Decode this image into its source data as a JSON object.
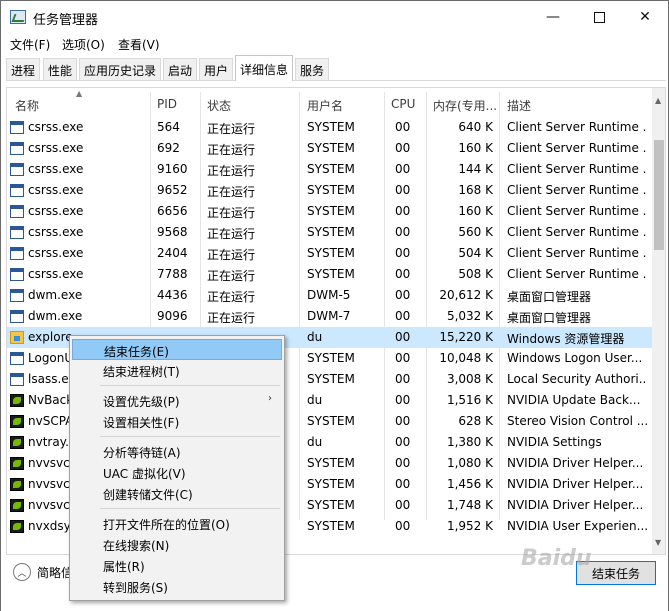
{
  "window": {
    "title": "任务管理器"
  },
  "menubar": [
    "文件(F)",
    "选项(O)",
    "查看(V)"
  ],
  "tabs": [
    {
      "label": "进程"
    },
    {
      "label": "性能"
    },
    {
      "label": "应用历史记录"
    },
    {
      "label": "启动"
    },
    {
      "label": "用户"
    },
    {
      "label": "详细信息",
      "active": true
    },
    {
      "label": "服务"
    }
  ],
  "columns": [
    "名称",
    "PID",
    "状态",
    "用户名",
    "CPU",
    "内存(专用...",
    "描述"
  ],
  "rows": [
    {
      "name": "csrss.exe",
      "pid": "564",
      "status": "正在运行",
      "user": "SYSTEM",
      "cpu": "00",
      "mem": "640 K",
      "desc": "Client Server Runtime ...",
      "icon": "window-icon"
    },
    {
      "name": "csrss.exe",
      "pid": "692",
      "status": "正在运行",
      "user": "SYSTEM",
      "cpu": "00",
      "mem": "160 K",
      "desc": "Client Server Runtime ...",
      "icon": "window-icon"
    },
    {
      "name": "csrss.exe",
      "pid": "9160",
      "status": "正在运行",
      "user": "SYSTEM",
      "cpu": "00",
      "mem": "144 K",
      "desc": "Client Server Runtime ...",
      "icon": "window-icon"
    },
    {
      "name": "csrss.exe",
      "pid": "9652",
      "status": "正在运行",
      "user": "SYSTEM",
      "cpu": "00",
      "mem": "168 K",
      "desc": "Client Server Runtime ...",
      "icon": "window-icon"
    },
    {
      "name": "csrss.exe",
      "pid": "6656",
      "status": "正在运行",
      "user": "SYSTEM",
      "cpu": "00",
      "mem": "160 K",
      "desc": "Client Server Runtime ...",
      "icon": "window-icon"
    },
    {
      "name": "csrss.exe",
      "pid": "9568",
      "status": "正在运行",
      "user": "SYSTEM",
      "cpu": "00",
      "mem": "560 K",
      "desc": "Client Server Runtime ...",
      "icon": "window-icon"
    },
    {
      "name": "csrss.exe",
      "pid": "2404",
      "status": "正在运行",
      "user": "SYSTEM",
      "cpu": "00",
      "mem": "504 K",
      "desc": "Client Server Runtime ...",
      "icon": "window-icon"
    },
    {
      "name": "csrss.exe",
      "pid": "7788",
      "status": "正在运行",
      "user": "SYSTEM",
      "cpu": "00",
      "mem": "508 K",
      "desc": "Client Server Runtime ...",
      "icon": "window-icon"
    },
    {
      "name": "dwm.exe",
      "pid": "4436",
      "status": "正在运行",
      "user": "DWM-5",
      "cpu": "00",
      "mem": "20,612 K",
      "desc": "桌面窗口管理器",
      "icon": "window-icon"
    },
    {
      "name": "dwm.exe",
      "pid": "9096",
      "status": "正在运行",
      "user": "DWM-7",
      "cpu": "00",
      "mem": "5,032 K",
      "desc": "桌面窗口管理器",
      "icon": "window-icon"
    },
    {
      "name": "explore",
      "pid": "",
      "status": "",
      "user": "du",
      "cpu": "00",
      "mem": "15,220 K",
      "desc": "Windows 资源管理器",
      "icon": "explorer-icon",
      "selected": true
    },
    {
      "name": "LogonU",
      "pid": "",
      "status": "",
      "user": "SYSTEM",
      "cpu": "00",
      "mem": "10,048 K",
      "desc": "Windows Logon User...",
      "icon": "window-icon"
    },
    {
      "name": "lsass.ex",
      "pid": "",
      "status": "",
      "user": "SYSTEM",
      "cpu": "00",
      "mem": "3,008 K",
      "desc": "Local Security Authori...",
      "icon": "window-icon"
    },
    {
      "name": "NvBack",
      "pid": "",
      "status": "",
      "user": "du",
      "cpu": "00",
      "mem": "1,516 K",
      "desc": "NVIDIA Update Back...",
      "icon": "nvidia-icon"
    },
    {
      "name": "nvSCPA",
      "pid": "",
      "status": "",
      "user": "SYSTEM",
      "cpu": "00",
      "mem": "628 K",
      "desc": "Stereo Vision Control ...",
      "icon": "nvidia-icon"
    },
    {
      "name": "nvtray.e",
      "pid": "",
      "status": "",
      "user": "du",
      "cpu": "00",
      "mem": "1,380 K",
      "desc": "NVIDIA Settings",
      "icon": "nvidia-icon"
    },
    {
      "name": "nvvsvc.",
      "pid": "",
      "status": "",
      "user": "SYSTEM",
      "cpu": "00",
      "mem": "1,080 K",
      "desc": "NVIDIA Driver Helper...",
      "icon": "nvidia-icon"
    },
    {
      "name": "nvvsvc.",
      "pid": "",
      "status": "",
      "user": "SYSTEM",
      "cpu": "00",
      "mem": "1,456 K",
      "desc": "NVIDIA Driver Helper...",
      "icon": "nvidia-icon"
    },
    {
      "name": "nvvsvc.",
      "pid": "",
      "status": "",
      "user": "SYSTEM",
      "cpu": "00",
      "mem": "1,748 K",
      "desc": "NVIDIA Driver Helper...",
      "icon": "nvidia-icon"
    },
    {
      "name": "nvxdsyr",
      "pid": "",
      "status": "",
      "user": "SYSTEM",
      "cpu": "00",
      "mem": "1,952 K",
      "desc": "NVIDIA User Experien...",
      "icon": "nvidia-icon"
    }
  ],
  "context_menu": [
    {
      "label": "结束任务(E)",
      "highlighted": true
    },
    {
      "label": "结束进程树(T)"
    },
    {
      "separator": true
    },
    {
      "label": "设置优先级(P)",
      "submenu": true
    },
    {
      "label": "设置相关性(F)"
    },
    {
      "separator": true
    },
    {
      "label": "分析等待链(A)"
    },
    {
      "label": "UAC 虚拟化(V)"
    },
    {
      "label": "创建转储文件(C)"
    },
    {
      "separator": true
    },
    {
      "label": "打开文件所在的位置(O)"
    },
    {
      "label": "在线搜索(N)"
    },
    {
      "label": "属性(R)"
    },
    {
      "label": "转到服务(S)"
    }
  ],
  "footer": {
    "brief_label": "简略信",
    "end_task_label": "结束任务"
  },
  "watermark": "Baidu"
}
